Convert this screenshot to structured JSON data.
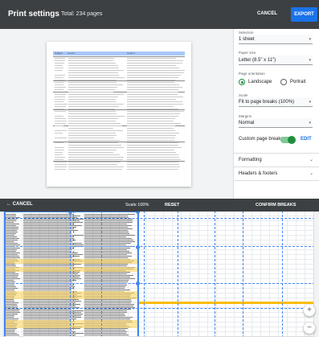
{
  "header": {
    "title": "Print settings",
    "total_pages": "Total: 234 pages",
    "cancel_label": "CANCEL",
    "export_label": "EXPORT"
  },
  "preview": {
    "columns": [
      "Subject",
      "Level 1",
      "Level 2"
    ]
  },
  "settings": {
    "selection_label": "Selection",
    "selection_value": "1 sheet",
    "paper_size_label": "Paper size",
    "paper_size_value": "Letter (8.5\" x 11\")",
    "orientation_label": "Page orientation",
    "landscape_label": "Landscape",
    "portrait_label": "Portrait",
    "orientation_selected": "Landscape",
    "scale_label": "Scale",
    "scale_value": "Fit to page breaks (100%)",
    "margins_label": "Margins",
    "margins_value": "Normal",
    "custom_breaks_label": "Custom page breaks",
    "custom_breaks_on": true,
    "edit_label": "EDIT",
    "formatting_label": "Formatting",
    "headers_footers_label": "Headers & footers"
  },
  "break_toolbar": {
    "cancel_label": "CANCEL",
    "scale_text": "Scale 100%",
    "reset_label": "RESET",
    "confirm_label": "CONFIRM BREAKS"
  },
  "zoom": {
    "plus": "+",
    "minus": "−"
  },
  "colors": {
    "toolbar_bg": "#3c4043",
    "accent": "#1a73e8",
    "toggle_on": "#1e8e3e",
    "break_line": "#4285f4",
    "highlight": "#fdd663"
  },
  "icons": {
    "back_arrow": "arrow-left-icon",
    "dropdown": "chevron-down-icon",
    "zoom_in": "plus-icon",
    "zoom_out": "minus-icon"
  }
}
